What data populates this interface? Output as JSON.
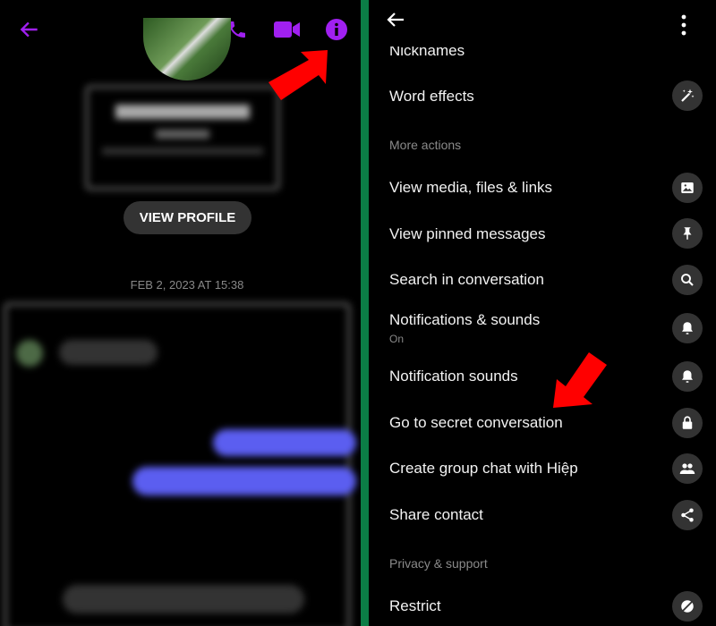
{
  "left": {
    "header": {
      "icons": [
        "back-arrow-icon",
        "phone-icon",
        "video-camera-icon",
        "info-icon"
      ],
      "accent": "#a020f0"
    },
    "view_profile": "VIEW PROFILE",
    "timestamp": "FEB 2, 2023 AT 15:38"
  },
  "right": {
    "header": {
      "icons": [
        "back-arrow-icon",
        "more-vertical-icon"
      ]
    },
    "items": [
      {
        "label": "Nicknames"
      },
      {
        "label": "Word effects",
        "icon": "magic-wand-icon"
      },
      {
        "section": "More actions"
      },
      {
        "label": "View media, files & links",
        "icon": "image-icon"
      },
      {
        "label": "View pinned messages",
        "icon": "pin-icon"
      },
      {
        "label": "Search in conversation",
        "icon": "search-icon"
      },
      {
        "label": "Notifications & sounds",
        "sub": "On",
        "icon": "bell-icon"
      },
      {
        "label": "Notification sounds",
        "icon": "bell-icon"
      },
      {
        "label": "Go to secret conversation",
        "icon": "lock-icon"
      },
      {
        "label": "Create group chat with Hiệp",
        "icon": "people-icon"
      },
      {
        "label": "Share contact",
        "icon": "share-icon"
      },
      {
        "section": "Privacy & support"
      },
      {
        "label": "Restrict",
        "icon": "restrict-icon"
      }
    ]
  },
  "colors": {
    "divider": "#0b7d46",
    "annotation_arrow": "#ff0000",
    "bubble": "#5b5ef0"
  }
}
